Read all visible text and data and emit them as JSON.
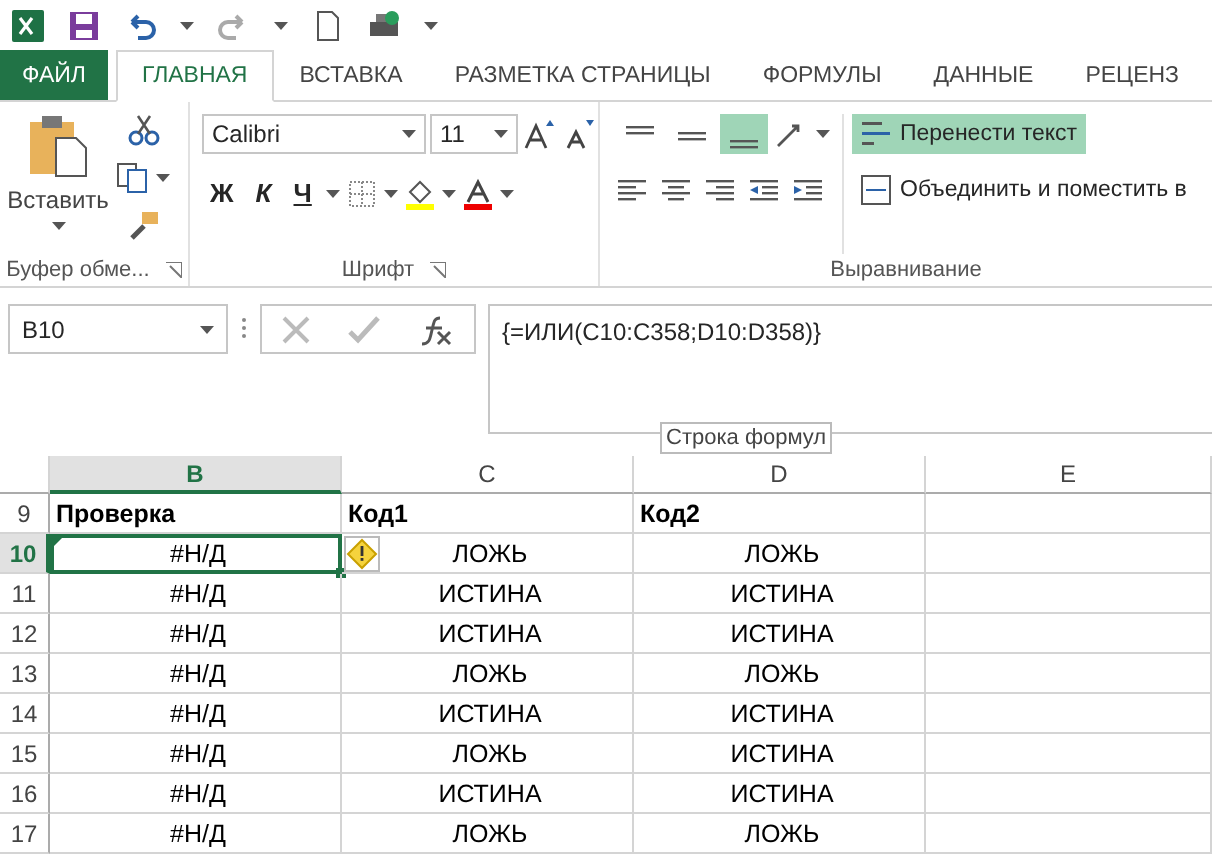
{
  "tabs": [
    {
      "label": "ФАЙЛ",
      "kind": "file",
      "selected": false
    },
    {
      "label": "ГЛАВНАЯ",
      "kind": "tab",
      "selected": true
    },
    {
      "label": "ВСТАВКА",
      "kind": "tab",
      "selected": false
    },
    {
      "label": "РАЗМЕТКА СТРАНИЦЫ",
      "kind": "tab",
      "selected": false
    },
    {
      "label": "ФОРМУЛЫ",
      "kind": "tab",
      "selected": false
    },
    {
      "label": "ДАННЫЕ",
      "kind": "tab",
      "selected": false
    },
    {
      "label": "РЕЦЕНЗ",
      "kind": "tab",
      "selected": false
    }
  ],
  "clipboard": {
    "paste_label": "Вставить",
    "title": "Буфер обме..."
  },
  "font": {
    "font_name": "Calibri",
    "font_size": "11",
    "bold": "Ж",
    "italic": "К",
    "underline": "Ч",
    "title": "Шрифт"
  },
  "alignment": {
    "vertical_align": [
      {
        "selected": false
      },
      {
        "selected": false
      },
      {
        "selected": true
      }
    ],
    "wrap_text": {
      "label": "Перенести текст",
      "on": true
    },
    "merge": {
      "label": "Объединить и поместить в",
      "on": false
    },
    "title": "Выравнивание"
  },
  "formula_bar": {
    "name_box": "B10",
    "formula": "{=ИЛИ(C10:C358;D10:D358)}",
    "tooltip": "Строка формул"
  },
  "sheet": {
    "columns": [
      {
        "label": "B",
        "selected": true
      },
      {
        "label": "C",
        "selected": false
      },
      {
        "label": "D",
        "selected": false
      },
      {
        "label": "E",
        "selected": false
      }
    ],
    "rows": [
      {
        "number": "9",
        "kind": "header",
        "selected": false,
        "cells": [
          "Проверка",
          "Код1",
          "Код2"
        ]
      },
      {
        "number": "10",
        "kind": "data",
        "selected": true,
        "warning": true,
        "cells": [
          "#Н/Д",
          "ЛОЖЬ",
          "ЛОЖЬ"
        ]
      },
      {
        "number": "11",
        "kind": "data",
        "selected": false,
        "cells": [
          "#Н/Д",
          "ИСТИНА",
          "ИСТИНА"
        ]
      },
      {
        "number": "12",
        "kind": "data",
        "selected": false,
        "cells": [
          "#Н/Д",
          "ИСТИНА",
          "ИСТИНА"
        ]
      },
      {
        "number": "13",
        "kind": "data",
        "selected": false,
        "cells": [
          "#Н/Д",
          "ЛОЖЬ",
          "ЛОЖЬ"
        ]
      },
      {
        "number": "14",
        "kind": "data",
        "selected": false,
        "cells": [
          "#Н/Д",
          "ИСТИНА",
          "ИСТИНА"
        ]
      },
      {
        "number": "15",
        "kind": "data",
        "selected": false,
        "cells": [
          "#Н/Д",
          "ЛОЖЬ",
          "ИСТИНА"
        ]
      },
      {
        "number": "16",
        "kind": "data",
        "selected": false,
        "cells": [
          "#Н/Д",
          "ИСТИНА",
          "ИСТИНА"
        ]
      },
      {
        "number": "17",
        "kind": "data",
        "selected": false,
        "cells": [
          "#Н/Д",
          "ЛОЖЬ",
          "ЛОЖЬ"
        ]
      }
    ]
  }
}
